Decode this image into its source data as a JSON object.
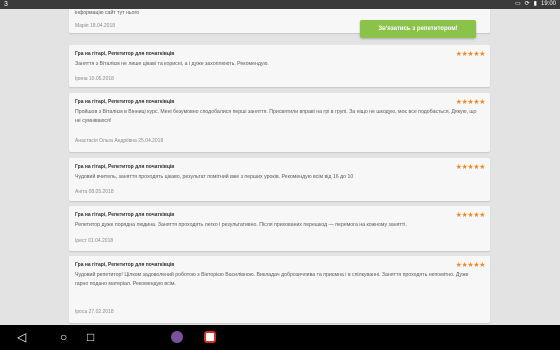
{
  "status_bar": {
    "left_text": "3",
    "time": "19:00",
    "icons": [
      "cast-icon",
      "screen-rotation-icon",
      "battery-icon"
    ]
  },
  "cta": {
    "label": "Зв'язатись з репетитором!"
  },
  "reviews": [
    {
      "title": "",
      "text": "інформацію сайт тут нього",
      "meta": "Марія 18.04.2018"
    },
    {
      "title": "Гра на гітарі, Репетитор для початківців",
      "stars": "★★★★★",
      "text": "Заняття з Віталієм не лише цікаві та корисні, а і дуже захоплюють. Рекомендую.",
      "meta": "Ірина 10.05.2018"
    },
    {
      "title": "Гра на гітарі, Репетитор для початківців",
      "stars": "★★★★★",
      "text": "Пройшов з Віталієм в Вінниці курс. Мені безумовно сподобалися перші заняття. Присвятили вправі на грі в групі. За ніщо не шкодую, моє все подобається. Дякую, що не сумніваюся!",
      "meta": "Анастасія Ольга Андріївна 25.04.2018"
    },
    {
      "title": "Гра на гітарі, Репетитор для початківців",
      "stars": "★★★★★",
      "text": "Чудовий вчитель, заняття проходять цікаво, результат помітний вже з перших уроків. Рекомендую всім від 16 до 10",
      "meta": "Аніта 08.05.2018"
    },
    {
      "title": "Гра на гітарі, Репетитор для початківців",
      "stars": "★★★★★",
      "text": "Репетитор дуже порядна людина. Заняття проходять легко і результативно. Після прихованих перешкод — перемога на кожному занятті.",
      "meta": "Ірест 01.04.2018"
    },
    {
      "title": "Гра на гітарі, Репетитор для початківців",
      "stars": "★★★★★",
      "text": "Чудовий репетитор! Цілком задоволений роботою з Вікторією Василівною. Викладач доброзичлива та приємна і в спілкуванні. Заняття проходять непомітно. Дуже гарно подано матеріал. Рекомендую всім.",
      "meta": "Іроса 27.02.2018"
    }
  ],
  "nav_bar": {
    "back": "◁",
    "home": "○",
    "recents": "□",
    "apps": [
      "viber-icon",
      "gmail-icon"
    ]
  }
}
